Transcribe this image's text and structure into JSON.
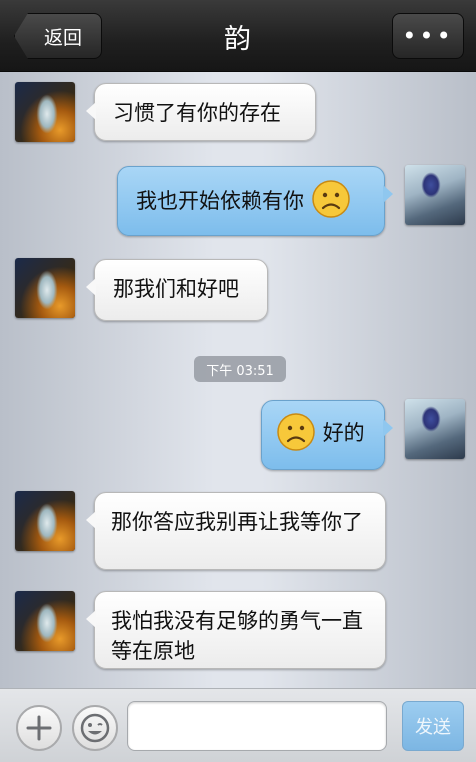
{
  "header": {
    "back_label": "返回",
    "title": "韵",
    "more_label": "•••"
  },
  "messages": [
    {
      "side": "left",
      "text": "习惯了有你的存在"
    },
    {
      "side": "right",
      "text": "我也开始依赖有你",
      "emoji": "sad-face-icon"
    },
    {
      "side": "left",
      "text": "那我们和好吧"
    },
    {
      "side": "right",
      "text": "好的",
      "emoji": "sad-face-icon"
    },
    {
      "side": "left",
      "text": "那你答应我别再让我等你了"
    },
    {
      "side": "left",
      "text": "我怕我没有足够的勇气一直等在原地"
    }
  ],
  "timestamp": "下午 03:51",
  "input_bar": {
    "input_value": "",
    "send_label": "发送"
  },
  "colors": {
    "right_bubble": "#8fc7ef",
    "left_bubble": "#f5f5f5",
    "navbar": "#1f1f1f"
  }
}
